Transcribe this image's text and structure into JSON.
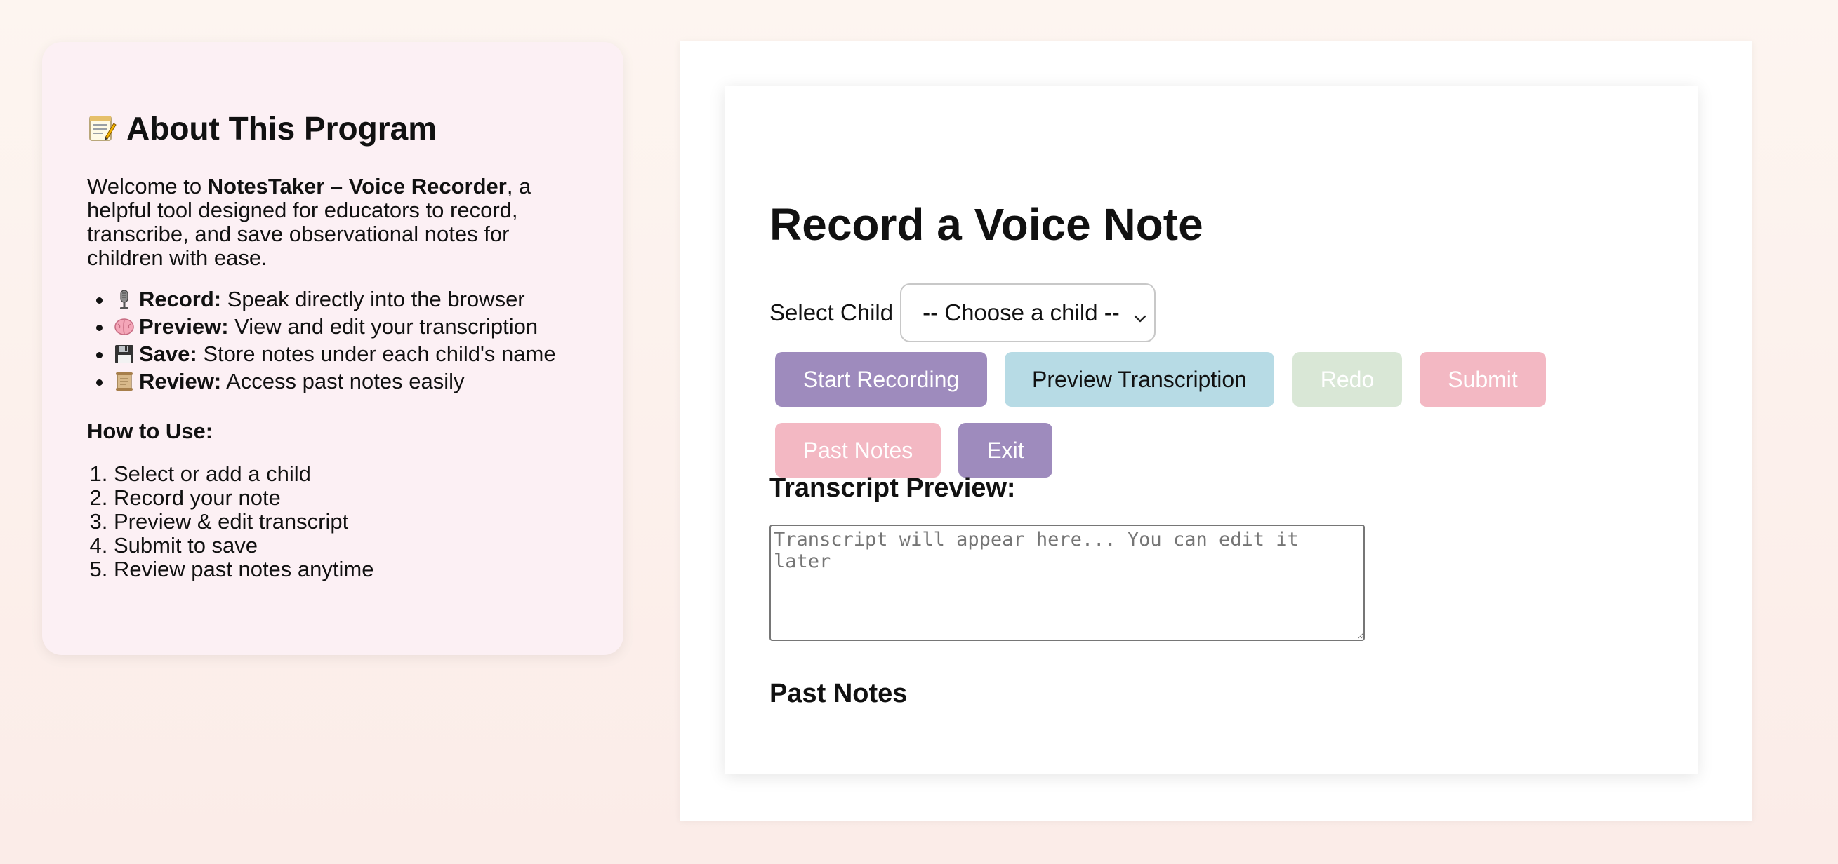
{
  "sidebar": {
    "title": "About This Program",
    "intro_prefix": "Welcome to ",
    "intro_app": "NotesTaker – Voice Recorder",
    "intro_suffix": ", a helpful tool designed for educators to record, transcribe, and save observational notes for children with ease.",
    "features": [
      {
        "icon": "microphone-icon",
        "label": "Record:",
        "text": " Speak directly into the browser"
      },
      {
        "icon": "brain-icon",
        "label": "Preview:",
        "text": " View and edit your transcription"
      },
      {
        "icon": "floppy-disk-icon",
        "label": "Save:",
        "text": " Store notes under each child's name"
      },
      {
        "icon": "scroll-icon",
        "label": "Review:",
        "text": " Access past notes easily"
      }
    ],
    "howto_title": "How to Use:",
    "steps": [
      "Select or add a child",
      "Record your note",
      "Preview & edit transcript",
      "Submit to save",
      "Review past notes anytime"
    ]
  },
  "main": {
    "title": "Record a Voice Note",
    "select_label": "Select Child",
    "select_value": "-- Choose a child --",
    "buttons": {
      "start": "Start Recording",
      "preview": "Preview Transcription",
      "redo": "Redo",
      "submit": "Submit",
      "past_notes": "Past Notes",
      "exit": "Exit"
    },
    "transcript_heading": "Transcript Preview:",
    "transcript_placeholder": "Transcript will appear here... You can edit it later",
    "past_notes_heading": "Past Notes"
  },
  "colors": {
    "accent_purple": "#9e8bbd",
    "accent_blue": "#b7dbe5",
    "disabled_green": "#d9e7d6",
    "disabled_pink": "#f3b8c3",
    "sidebar_bg": "#fcf0f4"
  }
}
